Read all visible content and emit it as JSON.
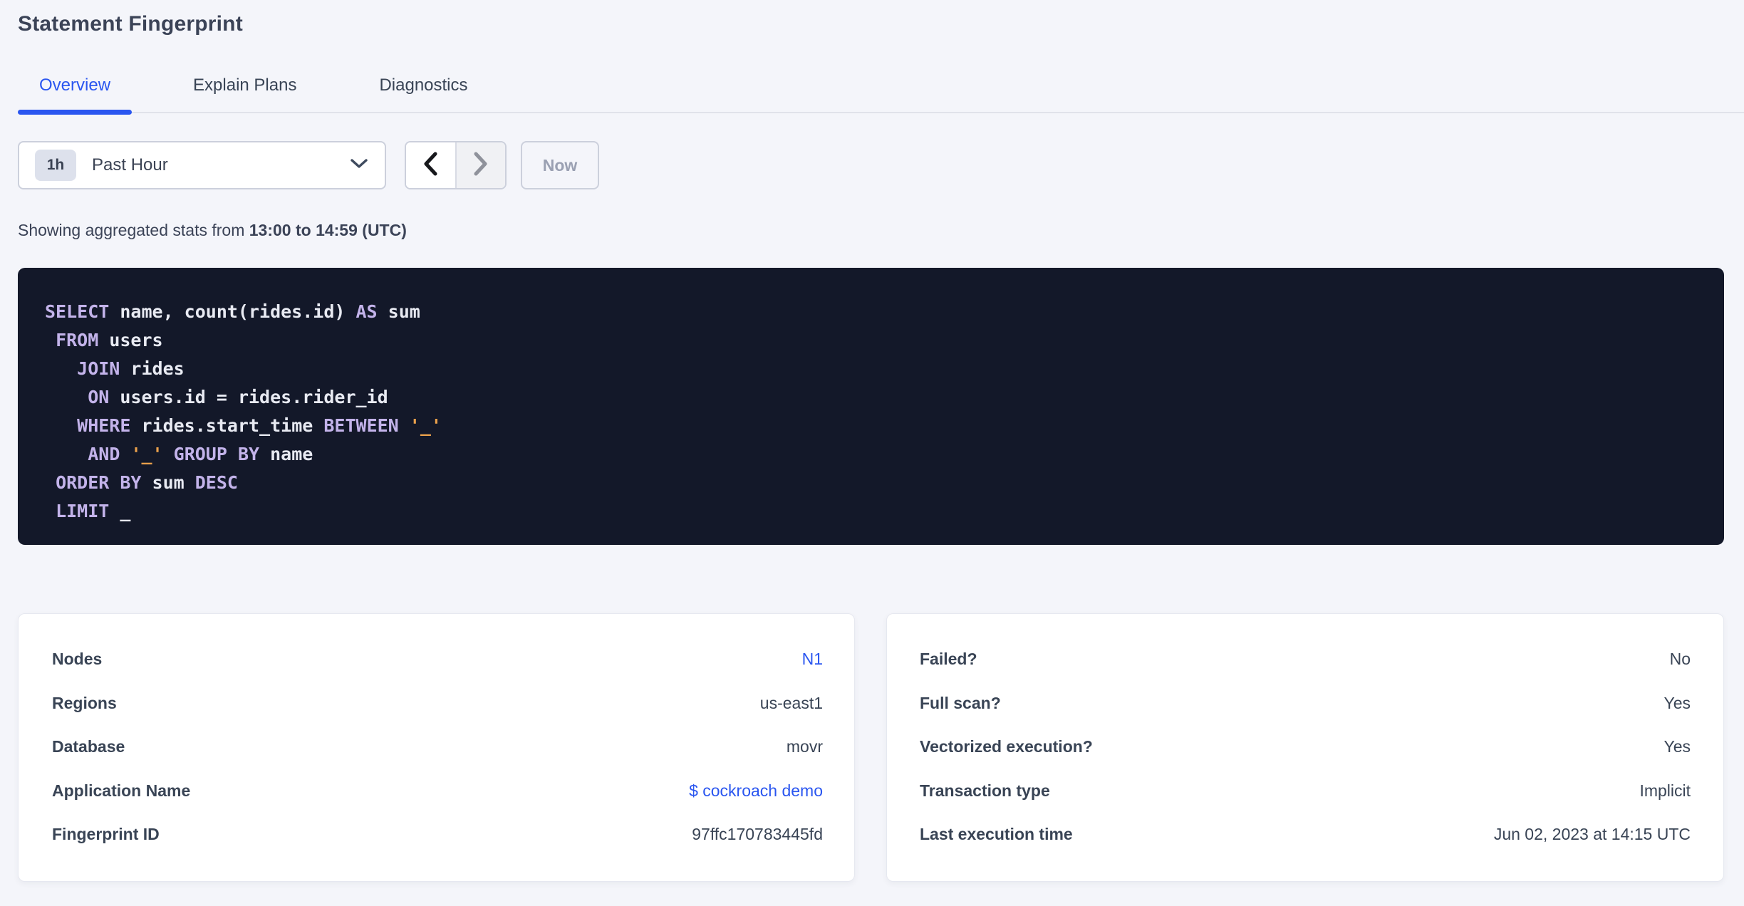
{
  "header": {
    "title": "Statement Fingerprint"
  },
  "tabs": [
    {
      "label": "Overview",
      "active": true
    },
    {
      "label": "Explain Plans",
      "active": false
    },
    {
      "label": "Diagnostics",
      "active": false
    }
  ],
  "toolbar": {
    "range_badge": "1h",
    "range_label": "Past Hour",
    "prev_icon": "chevron-left-icon",
    "next_icon": "chevron-right-icon",
    "now_label": "Now"
  },
  "stats": {
    "prefix": "Showing aggregated stats from ",
    "range": "13:00 to 14:59 (UTC)"
  },
  "sql": {
    "lines": [
      [
        {
          "t": "SELECT",
          "k": "keyword"
        },
        {
          "t": " name, count(rides.id) ",
          "k": "plain"
        },
        {
          "t": "AS",
          "k": "keyword"
        },
        {
          "t": " sum",
          "k": "plain"
        }
      ],
      [
        {
          "t": " ",
          "k": "plain"
        },
        {
          "t": "FROM",
          "k": "keyword"
        },
        {
          "t": " users",
          "k": "plain"
        }
      ],
      [
        {
          "t": "   ",
          "k": "plain"
        },
        {
          "t": "JOIN",
          "k": "keyword"
        },
        {
          "t": " rides",
          "k": "plain"
        }
      ],
      [
        {
          "t": "    ",
          "k": "plain"
        },
        {
          "t": "ON",
          "k": "keyword"
        },
        {
          "t": " users.id = rides.rider_id",
          "k": "plain"
        }
      ],
      [
        {
          "t": "   ",
          "k": "plain"
        },
        {
          "t": "WHERE",
          "k": "keyword"
        },
        {
          "t": " rides.start_time ",
          "k": "plain"
        },
        {
          "t": "BETWEEN",
          "k": "keyword"
        },
        {
          "t": " ",
          "k": "plain"
        },
        {
          "t": "'_'",
          "k": "string"
        }
      ],
      [
        {
          "t": "    ",
          "k": "plain"
        },
        {
          "t": "AND",
          "k": "keyword"
        },
        {
          "t": " ",
          "k": "plain"
        },
        {
          "t": "'_'",
          "k": "string"
        },
        {
          "t": " ",
          "k": "plain"
        },
        {
          "t": "GROUP BY",
          "k": "keyword"
        },
        {
          "t": " name",
          "k": "plain"
        }
      ],
      [
        {
          "t": " ",
          "k": "plain"
        },
        {
          "t": "ORDER BY",
          "k": "keyword"
        },
        {
          "t": " sum ",
          "k": "plain"
        },
        {
          "t": "DESC",
          "k": "keyword"
        }
      ],
      [
        {
          "t": " ",
          "k": "plain"
        },
        {
          "t": "LIMIT",
          "k": "keyword"
        },
        {
          "t": " _",
          "k": "plain"
        }
      ]
    ]
  },
  "cards": {
    "left": {
      "rows": [
        {
          "label": "Nodes",
          "value": "N1"
        },
        {
          "label": "Regions",
          "value": "us-east1"
        },
        {
          "label": "Database",
          "value": "movr"
        },
        {
          "label": "Application Name",
          "value": "$ cockroach demo"
        },
        {
          "label": "Fingerprint ID",
          "value": "97ffc170783445fd"
        }
      ]
    },
    "right": {
      "rows": [
        {
          "label": "Failed?",
          "value": "No"
        },
        {
          "label": "Full scan?",
          "value": "Yes"
        },
        {
          "label": "Vectorized execution?",
          "value": "Yes"
        },
        {
          "label": "Transaction type",
          "value": "Implicit"
        },
        {
          "label": "Last execution time",
          "value": "Jun 02, 2023 at 14:15 UTC"
        }
      ]
    }
  },
  "colors": {
    "accent_blue": "#2a56f0",
    "page_background": "#f4f5fa",
    "code_background": "#131829",
    "code_keyword": "#c3b3ea",
    "code_string": "#eba14c",
    "text_dark": "#394455"
  }
}
